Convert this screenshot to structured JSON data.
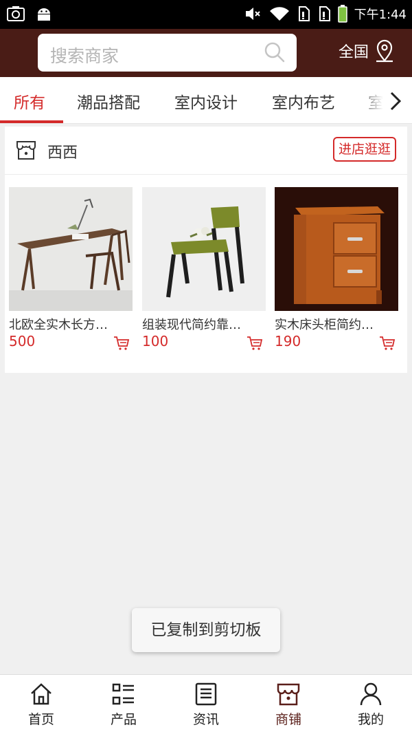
{
  "status_bar": {
    "time": "下午1:44"
  },
  "header": {
    "search_placeholder": "搜索商家",
    "region": "全国"
  },
  "tabs": [
    {
      "label": "所有",
      "active": true
    },
    {
      "label": "潮品搭配",
      "active": false
    },
    {
      "label": "室内设计",
      "active": false
    },
    {
      "label": "室内布艺",
      "active": false
    },
    {
      "label": "室",
      "active": false
    }
  ],
  "store": {
    "name": "西西",
    "visit_label": "进店逛逛",
    "products": [
      {
        "name": "北欧全实木长方…",
        "price": "500"
      },
      {
        "name": "组装现代简约靠…",
        "price": "100"
      },
      {
        "name": "实木床头柜简约…",
        "price": "190"
      }
    ]
  },
  "toast": "已复制到剪切板",
  "bottom_nav": [
    {
      "label": "首页",
      "icon": "home-icon"
    },
    {
      "label": "产品",
      "icon": "list-icon"
    },
    {
      "label": "资讯",
      "icon": "news-icon"
    },
    {
      "label": "商铺",
      "icon": "store-icon",
      "active": true
    },
    {
      "label": "我的",
      "icon": "user-icon"
    }
  ],
  "colors": {
    "header_bg": "#4a1c16",
    "accent": "#d42a2a"
  }
}
